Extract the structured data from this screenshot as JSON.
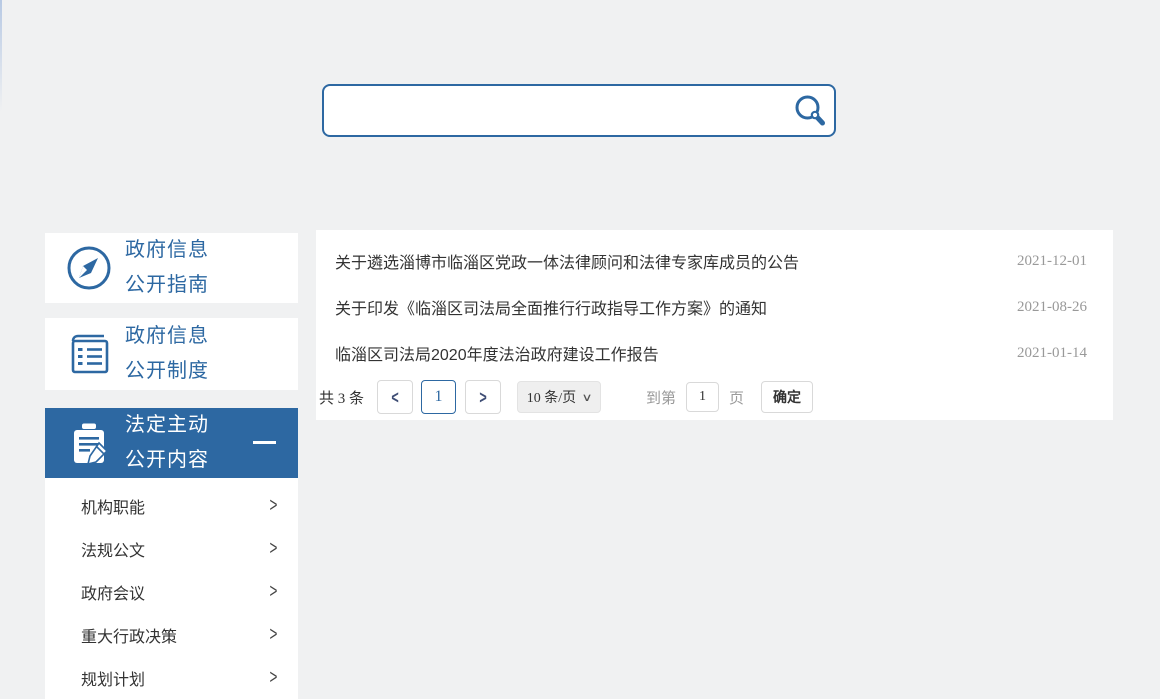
{
  "colors": {
    "accent_blue": "#2d68a2",
    "active_item_bg": "#2d68a2",
    "page_bg": "#f0f1f2",
    "panel_bg": "#ffffff",
    "date_gray": "#999999"
  },
  "icons": {
    "search": "magnifier-icon",
    "sidebar_item_1": "compass-icon",
    "sidebar_item_2": "notebook-icon",
    "sidebar_item_3": "clipboard-pencil-icon",
    "active_collapse": "minus-icon",
    "submenu_arrow": "chevron-right-icon",
    "select_arrow": "chevron-down-icon"
  },
  "search": {
    "value": "",
    "placeholder": ""
  },
  "sidebar": {
    "items": [
      {
        "line1": "政府信息",
        "line2": "公开指南",
        "active": false
      },
      {
        "line1": "政府信息",
        "line2": "公开制度",
        "active": false
      },
      {
        "line1": "法定主动",
        "line2": "公开内容",
        "active": true
      }
    ],
    "submenu": [
      {
        "label": "机构职能",
        "arrow": ">"
      },
      {
        "label": "法规公文",
        "arrow": ">"
      },
      {
        "label": "政府会议",
        "arrow": ">"
      },
      {
        "label": "重大行政决策",
        "arrow": ">"
      },
      {
        "label": "规划计划",
        "arrow": ">"
      }
    ]
  },
  "articles": [
    {
      "title": "关于遴选淄博市临淄区党政一体法律顾问和法律专家库成员的公告",
      "date": "2021-12-01"
    },
    {
      "title": "关于印发《临淄区司法局全面推行行政指导工作方案》的通知",
      "date": "2021-08-26"
    },
    {
      "title": "临淄区司法局2020年度法治政府建设工作报告",
      "date": "2021-01-14"
    }
  ],
  "pagination": {
    "total_text": "共 3 条",
    "prev_arrow": "<",
    "current_page": "1",
    "next_arrow": ">",
    "page_size_label": "10 条/页",
    "select_chevron": "∨",
    "goto_prefix": "到第",
    "goto_value": "1",
    "goto_suffix": "页",
    "confirm_label": "确定"
  }
}
